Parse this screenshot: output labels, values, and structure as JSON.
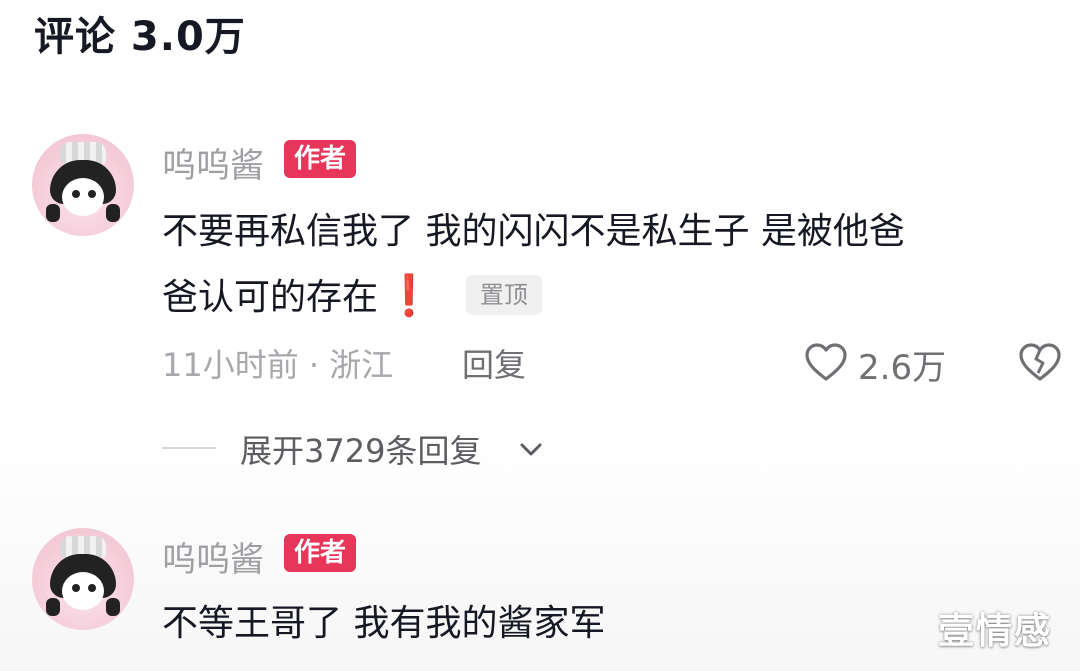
{
  "header": {
    "title": "评论 3.0万"
  },
  "comments": [
    {
      "username": "呜呜酱",
      "author_tag": "作者",
      "text_line1": "不要再私信我了 我的闪闪不是私生子 是被他爸",
      "text_line2": "爸认可的存在",
      "emoji": "❗",
      "pin_tag": "置顶",
      "time_location": "11小时前 · 浙江",
      "reply_label": "回复",
      "like_count": "2.6万",
      "expand_replies": "展开3729条回复"
    },
    {
      "username": "呜呜酱",
      "author_tag": "作者",
      "text_line1": "不等王哥了 我有我的酱家军"
    }
  ],
  "watermark": "壹情感",
  "colors": {
    "author_tag": "#e8355a",
    "text": "#161823",
    "muted": "#a8a8ac"
  },
  "icons": [
    "heart-outline-icon",
    "broken-heart-icon",
    "chevron-down-icon"
  ]
}
